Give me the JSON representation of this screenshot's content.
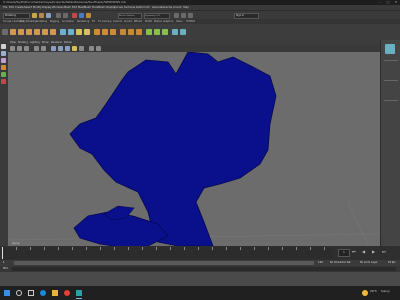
{
  "window": {
    "title": "C:/Users/Sydh/Documents/maya/projects/default/scenes/Sunflower/WINDOWS.mb",
    "minimize": "–",
    "maximize": "□",
    "close": "✕"
  },
  "menubar": {
    "items": [
      "File",
      "Edit",
      "Create",
      "Select",
      "Modify",
      "Display",
      "Windows",
      "Mesh",
      "Edit Mesh",
      "Mesh Tools",
      "Mesh Display",
      "Curves",
      "Surfaces",
      "Deform",
      "UV",
      "Generate",
      "Cache",
      "Arnold",
      "Help"
    ]
  },
  "statusline": {
    "mode": "Modeling",
    "selection_field": "No Live Surface",
    "symmetry": "Symmetry: Off",
    "signin": "Sign In"
  },
  "shelf": {
    "tabs": [
      "Curves / Surfaces",
      "Poly Modeling",
      "Sculpting",
      "Rigging",
      "Animation",
      "Rendering",
      "FX",
      "FX Caching",
      "Custom",
      "Arnold",
      "Bifrost",
      "MASH",
      "Motion Graphics",
      "XGen",
      "TURTLE"
    ]
  },
  "viewport": {
    "menus": [
      "View",
      "Shading",
      "Lighting",
      "Show",
      "Renderer",
      "Panels"
    ],
    "camera_label": "persp",
    "object_color": "#0a0f8c",
    "background_color": "#6c6c6c"
  },
  "timeline": {
    "ticks": [
      "1",
      "5",
      "10",
      "15",
      "20",
      "25",
      "30",
      "35",
      "40",
      "45",
      "50",
      "55",
      "60",
      "65",
      "70",
      "75",
      "80",
      "85",
      "90",
      "95",
      "100",
      "105",
      "110",
      "115",
      "120"
    ],
    "current_frame": "1",
    "range_start": "1",
    "range_end": "120",
    "fps": "24 fps",
    "char_set": "No Character Set",
    "anim_layer": "No Anim Layer"
  },
  "cmdline": {
    "label": "MEL"
  },
  "taskbar": {
    "temperature": "20°C",
    "weather": "Sunny",
    "apps": [
      "search",
      "task-view",
      "edge",
      "explorer",
      "chrome",
      "maya"
    ]
  }
}
